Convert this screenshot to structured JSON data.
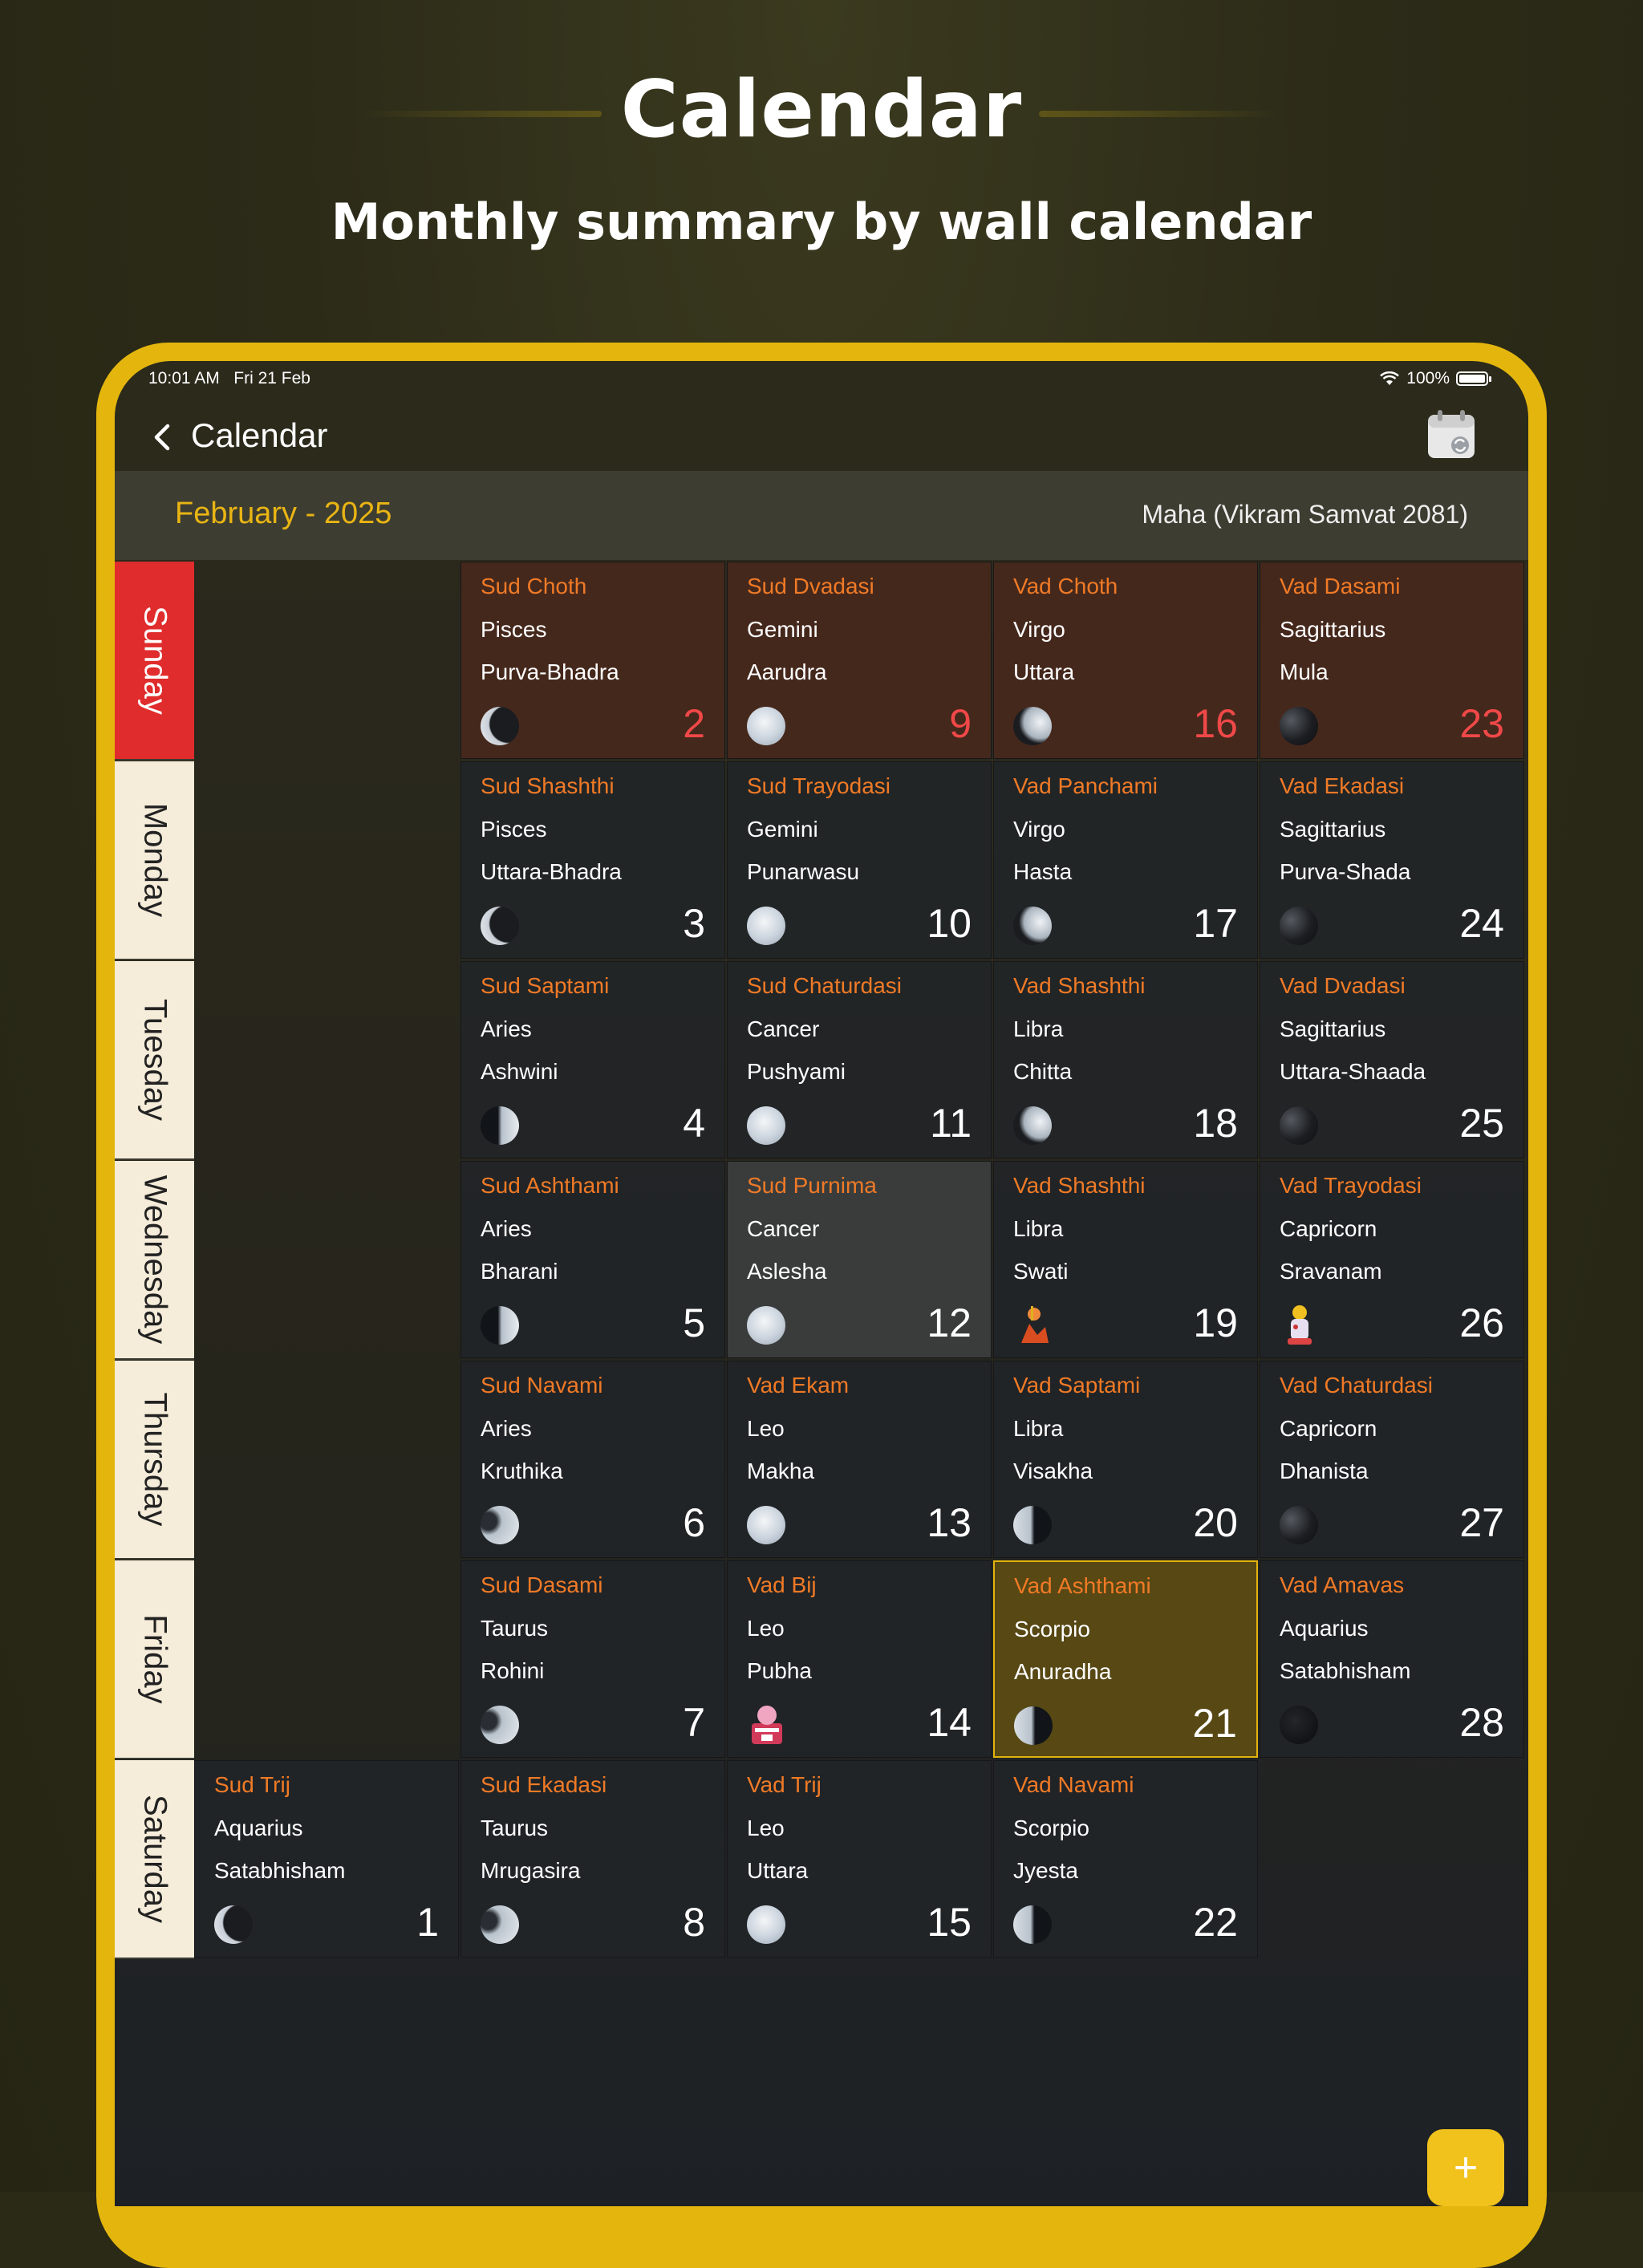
{
  "hero": {
    "title": "Calendar",
    "subtitle": "Monthly summary by wall calendar"
  },
  "status_bar": {
    "time": "10:01 AM",
    "date": "Fri 21 Feb",
    "battery": "100%"
  },
  "app_bar": {
    "title": "Calendar",
    "back_icon": "chevron-left-icon",
    "action_icon": "calendar-sync-icon"
  },
  "month_header": {
    "month": "February - 2025",
    "samvat": "Maha (Vikram Samvat 2081)"
  },
  "weekdays": [
    "Sunday",
    "Monday",
    "Tuesday",
    "Wednesday",
    "Thursday",
    "Friday",
    "Saturday"
  ],
  "days": [
    {
      "tithi": "Sud Trij",
      "rashi": "Aquarius",
      "nakshatra": "Satabhisham",
      "date": "1",
      "moon": "crescent"
    },
    {
      "tithi": "Sud Choth",
      "rashi": "Pisces",
      "nakshatra": "Purva-Bhadra",
      "date": "2",
      "moon": "crescent"
    },
    {
      "tithi": "Sud Shashthi",
      "rashi": "Pisces",
      "nakshatra": "Uttara-Bhadra",
      "date": "3",
      "moon": "crescent"
    },
    {
      "tithi": "Sud Saptami",
      "rashi": "Aries",
      "nakshatra": "Ashwini",
      "date": "4",
      "moon": "half"
    },
    {
      "tithi": "Sud Ashthami",
      "rashi": "Aries",
      "nakshatra": "Bharani",
      "date": "5",
      "moon": "half"
    },
    {
      "tithi": "Sud Navami",
      "rashi": "Aries",
      "nakshatra": "Kruthika",
      "date": "6",
      "moon": "gibbous"
    },
    {
      "tithi": "Sud Dasami",
      "rashi": "Taurus",
      "nakshatra": "Rohini",
      "date": "7",
      "moon": "gibbous"
    },
    {
      "tithi": "Sud Ekadasi",
      "rashi": "Taurus",
      "nakshatra": "Mrugasira",
      "date": "8",
      "moon": "gibbous"
    },
    {
      "tithi": "Sud Dvadasi",
      "rashi": "Gemini",
      "nakshatra": "Aarudra",
      "date": "9",
      "moon": "full"
    },
    {
      "tithi": "Sud Trayodasi",
      "rashi": "Gemini",
      "nakshatra": "Punarwasu",
      "date": "10",
      "moon": "full"
    },
    {
      "tithi": "Sud Chaturdasi",
      "rashi": "Cancer",
      "nakshatra": "Pushyami",
      "date": "11",
      "moon": "full"
    },
    {
      "tithi": "Sud Purnima",
      "rashi": "Cancer",
      "nakshatra": "Aslesha",
      "date": "12",
      "moon": "full"
    },
    {
      "tithi": "Vad Ekam",
      "rashi": "Leo",
      "nakshatra": "Makha",
      "date": "13",
      "moon": "full"
    },
    {
      "tithi": "Vad Bij",
      "rashi": "Leo",
      "nakshatra": "Pubha",
      "date": "14",
      "moon": "festival"
    },
    {
      "tithi": "Vad Trij",
      "rashi": "Leo",
      "nakshatra": "Uttara",
      "date": "15",
      "moon": "full"
    },
    {
      "tithi": "Vad Choth",
      "rashi": "Virgo",
      "nakshatra": "Uttara",
      "date": "16",
      "moon": "waning"
    },
    {
      "tithi": "Vad Panchami",
      "rashi": "Virgo",
      "nakshatra": "Hasta",
      "date": "17",
      "moon": "waning"
    },
    {
      "tithi": "Vad Shashthi",
      "rashi": "Libra",
      "nakshatra": "Chitta",
      "date": "18",
      "moon": "waning"
    },
    {
      "tithi": "Vad Shashthi",
      "rashi": "Libra",
      "nakshatra": "Swati",
      "date": "19",
      "moon": "festival"
    },
    {
      "tithi": "Vad Saptami",
      "rashi": "Libra",
      "nakshatra": "Visakha",
      "date": "20",
      "moon": "waninghalf"
    },
    {
      "tithi": "Vad Ashthami",
      "rashi": "Scorpio",
      "nakshatra": "Anuradha",
      "date": "21",
      "moon": "waninghalf"
    },
    {
      "tithi": "Vad Navami",
      "rashi": "Scorpio",
      "nakshatra": "Jyesta",
      "date": "22",
      "moon": "waninghalf"
    },
    {
      "tithi": "Vad Dasami",
      "rashi": "Sagittarius",
      "nakshatra": "Mula",
      "date": "23",
      "moon": "dark"
    },
    {
      "tithi": "Vad Ekadasi",
      "rashi": "Sagittarius",
      "nakshatra": "Purva-Shada",
      "date": "24",
      "moon": "dark"
    },
    {
      "tithi": "Vad Dvadasi",
      "rashi": "Sagittarius",
      "nakshatra": "Uttara-Shaada",
      "date": "25",
      "moon": "dark"
    },
    {
      "tithi": "Vad Trayodasi",
      "rashi": "Capricorn",
      "nakshatra": "Sravanam",
      "date": "26",
      "moon": "festival"
    },
    {
      "tithi": "Vad Chaturdasi",
      "rashi": "Capricorn",
      "nakshatra": "Dhanista",
      "date": "27",
      "moon": "dark"
    },
    {
      "tithi": "Vad Amavas",
      "rashi": "Aquarius",
      "nakshatra": "Satabhisham",
      "date": "28",
      "moon": "new"
    }
  ],
  "today_date": "21",
  "colors": {
    "accent": "#e4b60d",
    "tithi": "#f07a26",
    "sunday": "#e02c2c"
  },
  "fab": {
    "label": "+",
    "icon": "plus-icon"
  }
}
